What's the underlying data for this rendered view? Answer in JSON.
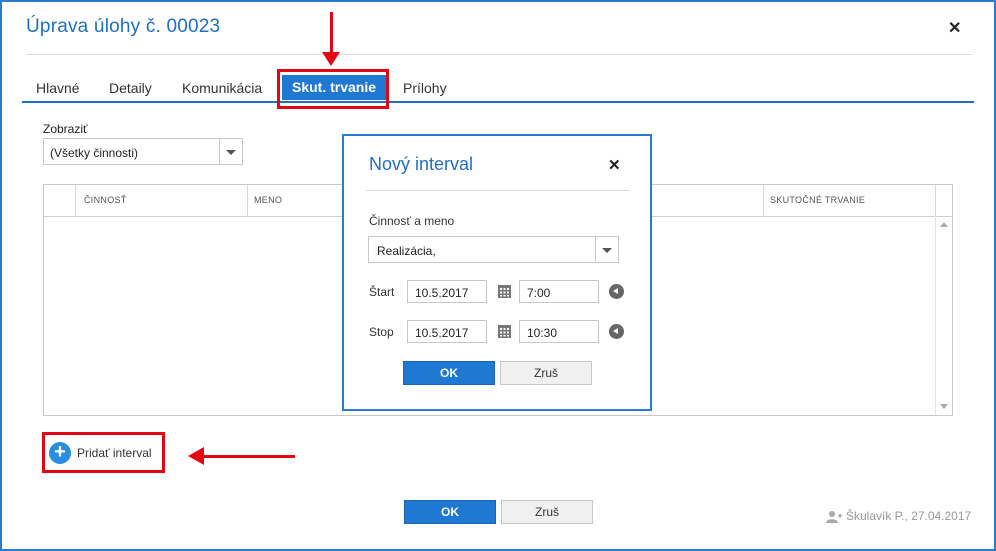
{
  "dialog": {
    "title": "Úprava úlohy č. 00023",
    "tabs": [
      "Hlavné",
      "Detaily",
      "Komunikácia",
      "Skut. trvanie",
      "Prílohy"
    ],
    "active_tab_index": 3
  },
  "filter": {
    "label": "Zobraziť",
    "value": "(Všetky činnosti)"
  },
  "grid": {
    "columns": [
      "ČINNOSŤ",
      "MENO",
      "SKUTOČNÉ TRVANIE"
    ],
    "rows": []
  },
  "add_interval_label": "Pridať interval",
  "footer": {
    "ok_label": "OK",
    "cancel_label": "Zruš",
    "info": "Škulavík P., 27.04.2017"
  },
  "modal": {
    "title": "Nový interval",
    "activity_label": "Činnosť a meno",
    "activity_value": "Realizácia,",
    "start_label": "Štart",
    "start_date": "10.5.2017",
    "start_time": "7:00",
    "stop_label": "Stop",
    "stop_date": "10.5.2017",
    "stop_time": "10:30",
    "ok_label": "OK",
    "cancel_label": "Zruš"
  },
  "colors": {
    "accent": "#1f78d1",
    "highlight": "#e30613"
  }
}
